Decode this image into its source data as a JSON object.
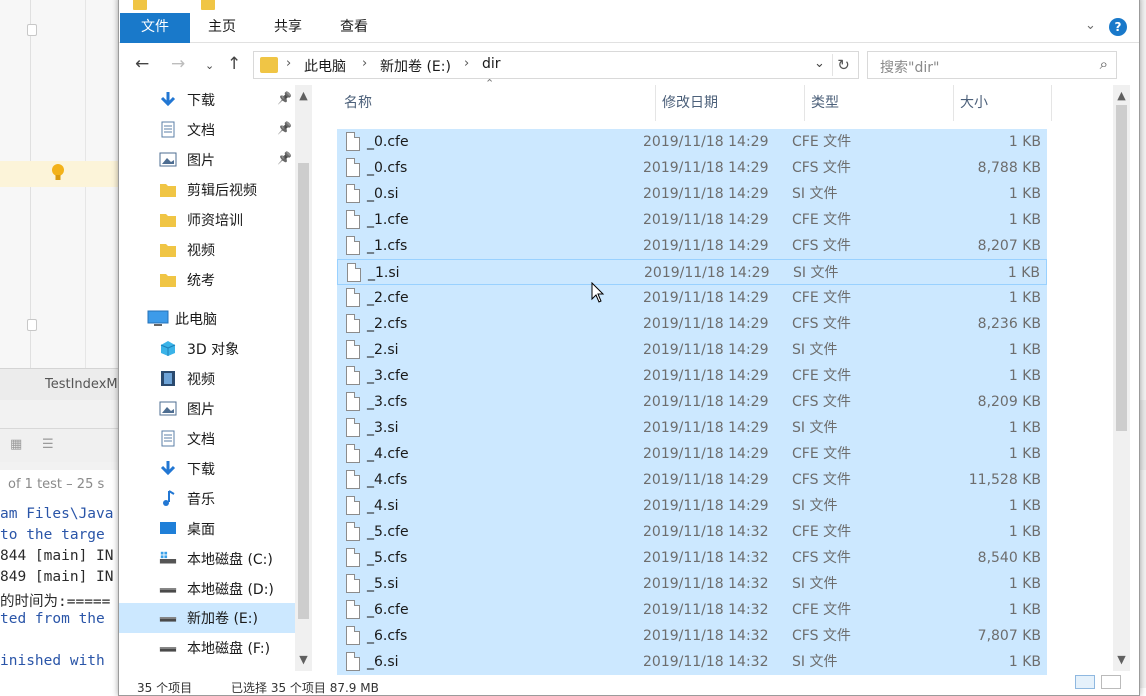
{
  "ide": {
    "tab_label": "TestIndexM",
    "test_status": "of 1 test – 25 s",
    "console_lines": [
      {
        "text": "am Files\\Java",
        "blue": true
      },
      {
        "text": " to the targe",
        "blue": true
      },
      {
        "text": "844 [main] IN",
        "blue": false
      },
      {
        "text": "849 [main] IN",
        "blue": false
      },
      {
        "text": "的时间为:=====",
        "blue": false
      },
      {
        "text": "ted from the",
        "blue": true
      },
      {
        "text": "",
        "blue": false
      },
      {
        "text": "inished with",
        "blue": true
      }
    ]
  },
  "ribbon": {
    "tabs": [
      "文件",
      "主页",
      "共享",
      "查看"
    ],
    "help": "?"
  },
  "address": {
    "breadcrumbs": [
      "此电脑",
      "新加卷 (E:)",
      "dir"
    ],
    "search_placeholder": "搜索\"dir\""
  },
  "nav_pane": {
    "items": [
      {
        "label": "下载",
        "icon": "download-icon",
        "pinned": true
      },
      {
        "label": "文档",
        "icon": "document-icon",
        "pinned": true
      },
      {
        "label": "图片",
        "icon": "pictures-icon",
        "pinned": true
      },
      {
        "label": "剪辑后视频",
        "icon": "folder-icon",
        "pinned": false
      },
      {
        "label": "师资培训",
        "icon": "folder-icon",
        "pinned": false
      },
      {
        "label": "视频",
        "icon": "folder-icon",
        "pinned": false
      },
      {
        "label": "统考",
        "icon": "folder-icon",
        "pinned": false
      },
      {
        "label": "此电脑",
        "icon": "this-pc-icon",
        "pinned": false
      },
      {
        "label": "3D 对象",
        "icon": "3d-objects-icon",
        "pinned": false
      },
      {
        "label": "视频",
        "icon": "videos-icon",
        "pinned": false
      },
      {
        "label": "图片",
        "icon": "pictures-icon",
        "pinned": false
      },
      {
        "label": "文档",
        "icon": "document-icon",
        "pinned": false
      },
      {
        "label": "下载",
        "icon": "download-icon",
        "pinned": false
      },
      {
        "label": "音乐",
        "icon": "music-icon",
        "pinned": false
      },
      {
        "label": "桌面",
        "icon": "desktop-icon",
        "pinned": false
      },
      {
        "label": "本地磁盘 (C:)",
        "icon": "system-drive-icon",
        "pinned": false
      },
      {
        "label": "本地磁盘 (D:)",
        "icon": "drive-icon",
        "pinned": false
      },
      {
        "label": "新加卷 (E:)",
        "icon": "drive-icon",
        "pinned": false,
        "selected": true
      },
      {
        "label": "本地磁盘 (F:)",
        "icon": "drive-icon",
        "pinned": false
      }
    ]
  },
  "file_list": {
    "columns": [
      "名称",
      "修改日期",
      "类型",
      "大小"
    ],
    "rows": [
      {
        "name": "_0.cfe",
        "date": "2019/11/18 14:29",
        "type": "CFE 文件",
        "size": "1 KB"
      },
      {
        "name": "_0.cfs",
        "date": "2019/11/18 14:29",
        "type": "CFS 文件",
        "size": "8,788 KB"
      },
      {
        "name": "_0.si",
        "date": "2019/11/18 14:29",
        "type": "SI 文件",
        "size": "1 KB"
      },
      {
        "name": "_1.cfe",
        "date": "2019/11/18 14:29",
        "type": "CFE 文件",
        "size": "1 KB"
      },
      {
        "name": "_1.cfs",
        "date": "2019/11/18 14:29",
        "type": "CFS 文件",
        "size": "8,207 KB"
      },
      {
        "name": "_1.si",
        "date": "2019/11/18 14:29",
        "type": "SI 文件",
        "size": "1 KB",
        "focus": true
      },
      {
        "name": "_2.cfe",
        "date": "2019/11/18 14:29",
        "type": "CFE 文件",
        "size": "1 KB"
      },
      {
        "name": "_2.cfs",
        "date": "2019/11/18 14:29",
        "type": "CFS 文件",
        "size": "8,236 KB"
      },
      {
        "name": "_2.si",
        "date": "2019/11/18 14:29",
        "type": "SI 文件",
        "size": "1 KB"
      },
      {
        "name": "_3.cfe",
        "date": "2019/11/18 14:29",
        "type": "CFE 文件",
        "size": "1 KB"
      },
      {
        "name": "_3.cfs",
        "date": "2019/11/18 14:29",
        "type": "CFS 文件",
        "size": "8,209 KB"
      },
      {
        "name": "_3.si",
        "date": "2019/11/18 14:29",
        "type": "SI 文件",
        "size": "1 KB"
      },
      {
        "name": "_4.cfe",
        "date": "2019/11/18 14:29",
        "type": "CFE 文件",
        "size": "1 KB"
      },
      {
        "name": "_4.cfs",
        "date": "2019/11/18 14:29",
        "type": "CFS 文件",
        "size": "11,528 KB"
      },
      {
        "name": "_4.si",
        "date": "2019/11/18 14:29",
        "type": "SI 文件",
        "size": "1 KB"
      },
      {
        "name": "_5.cfe",
        "date": "2019/11/18 14:32",
        "type": "CFE 文件",
        "size": "1 KB"
      },
      {
        "name": "_5.cfs",
        "date": "2019/11/18 14:32",
        "type": "CFS 文件",
        "size": "8,540 KB"
      },
      {
        "name": "_5.si",
        "date": "2019/11/18 14:32",
        "type": "SI 文件",
        "size": "1 KB"
      },
      {
        "name": "_6.cfe",
        "date": "2019/11/18 14:32",
        "type": "CFE 文件",
        "size": "1 KB"
      },
      {
        "name": "_6.cfs",
        "date": "2019/11/18 14:32",
        "type": "CFS 文件",
        "size": "7,807 KB"
      },
      {
        "name": "_6.si",
        "date": "2019/11/18 14:32",
        "type": "SI 文件",
        "size": "1 KB"
      }
    ]
  },
  "status_bar": {
    "item_count": "35 个项目",
    "selected": "已选择 35 个项目 87.9 MB"
  },
  "colors": {
    "accent": "#1979ca",
    "selection": "#cce8ff",
    "folder": "#f0c545"
  }
}
